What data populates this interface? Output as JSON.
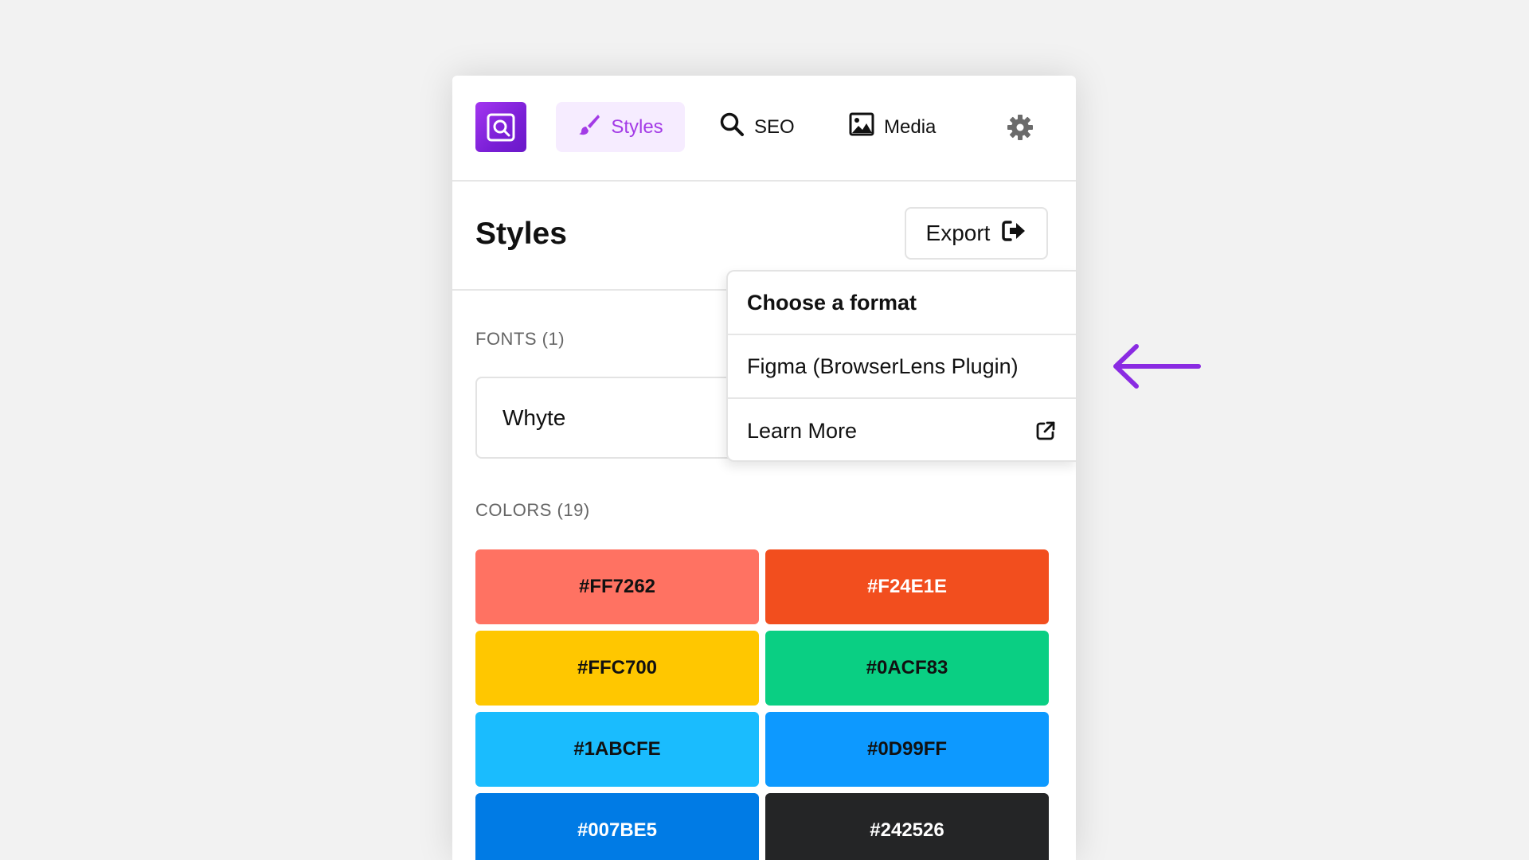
{
  "nav": {
    "tabs": [
      {
        "label": "Styles",
        "icon": "paintbrush-icon",
        "active": true
      },
      {
        "label": "SEO",
        "icon": "search-icon",
        "active": false
      },
      {
        "label": "Media",
        "icon": "image-icon",
        "active": false
      }
    ],
    "logo_icon": "browserlens-logo-icon",
    "settings_icon": "gear-icon"
  },
  "header": {
    "title": "Styles",
    "export_label": "Export",
    "export_icon": "sign-out-icon"
  },
  "dropdown": {
    "heading": "Choose a format",
    "items": [
      {
        "label": "Figma (BrowserLens Plugin)"
      },
      {
        "label": "Learn More",
        "icon": "external-link-icon"
      }
    ]
  },
  "fonts": {
    "label": "FONTS (1)",
    "items": [
      {
        "name": "Whyte"
      }
    ]
  },
  "colors": {
    "label": "COLORS (19)",
    "swatches": [
      {
        "hex": "#FF7262",
        "text_color": "#111111"
      },
      {
        "hex": "#F24E1E",
        "text_color": "#ffffff"
      },
      {
        "hex": "#FFC700",
        "text_color": "#111111"
      },
      {
        "hex": "#0ACF83",
        "text_color": "#111111"
      },
      {
        "hex": "#1ABCFE",
        "text_color": "#111111"
      },
      {
        "hex": "#0D99FF",
        "text_color": "#111111"
      },
      {
        "hex": "#007BE5",
        "text_color": "#ffffff"
      },
      {
        "hex": "#242526",
        "text_color": "#ffffff"
      }
    ]
  },
  "theme": {
    "accent": "#A33BE6",
    "arrow_color": "#8A2BE2"
  }
}
